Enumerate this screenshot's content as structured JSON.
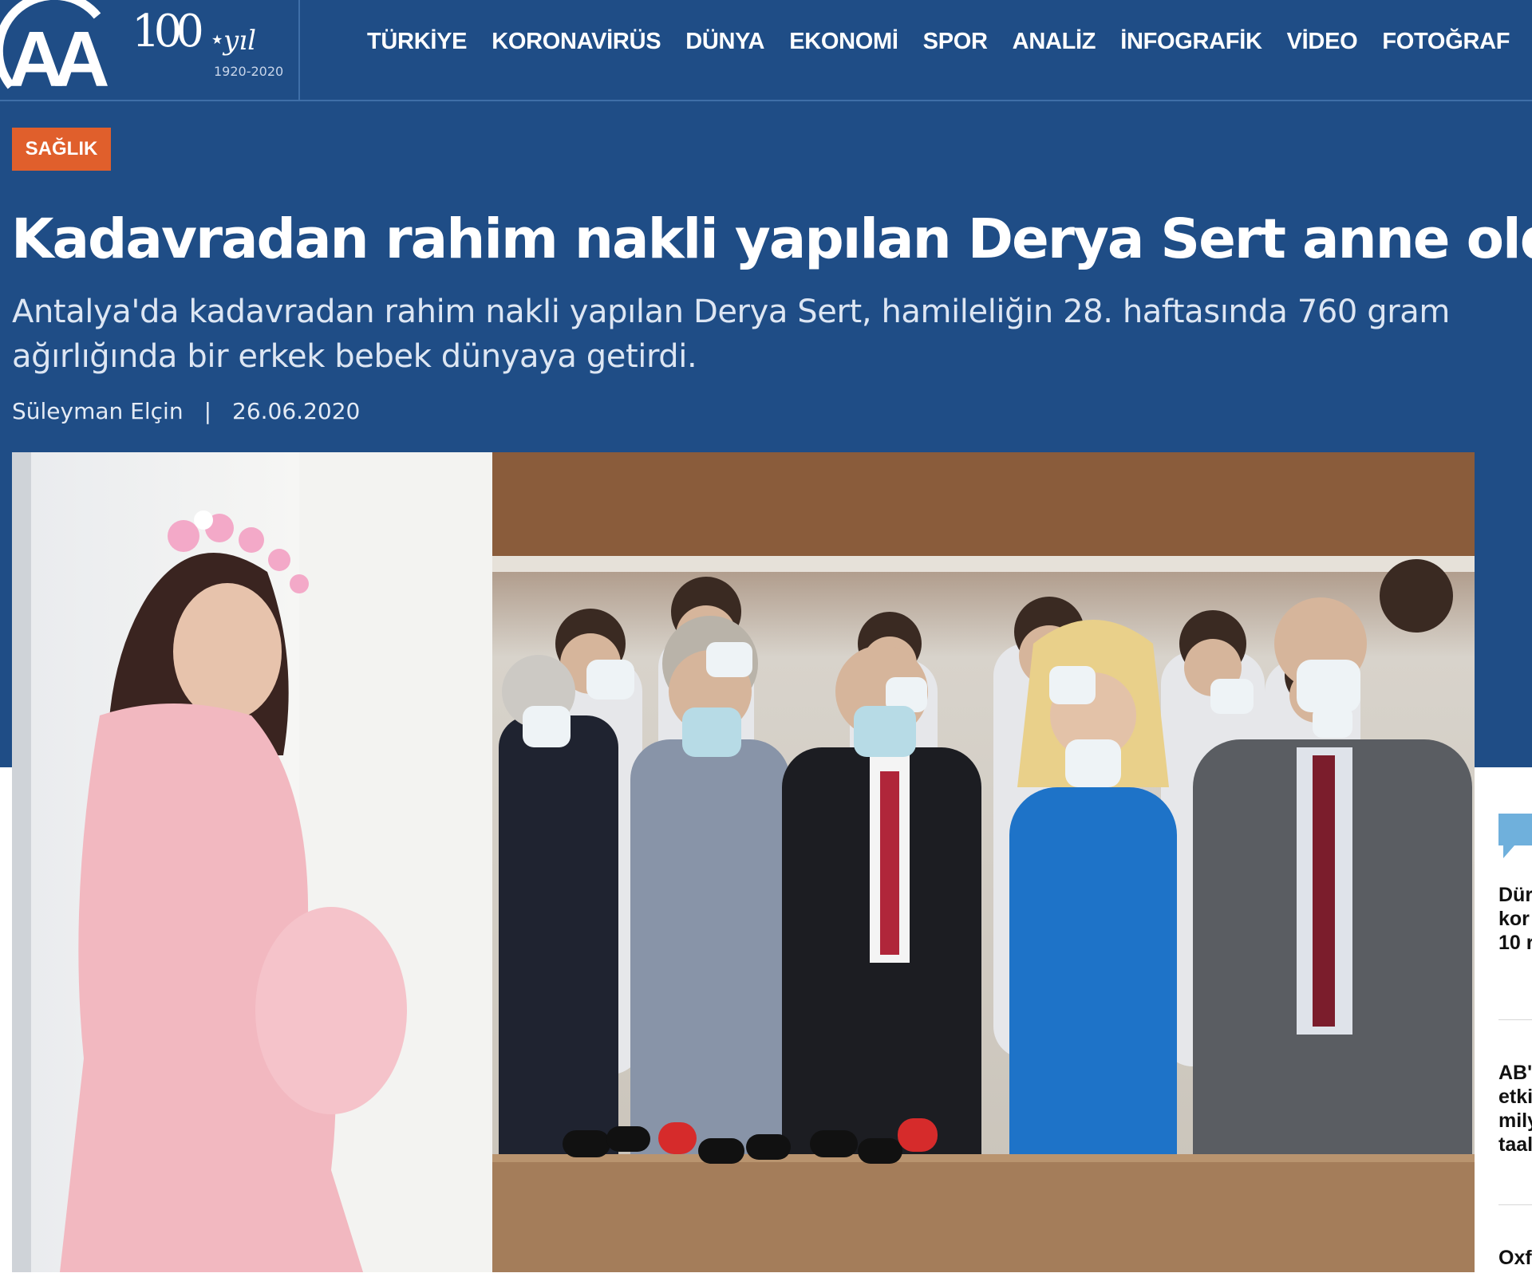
{
  "brand": {
    "logo_text": "AA",
    "centennial_number": "100",
    "centennial_unit": "yıl",
    "centennial_years": "1920-2020"
  },
  "nav": {
    "items": [
      "TÜRKİYE",
      "KORONAVİRÜS",
      "DÜNYA",
      "EKONOMİ",
      "SPOR",
      "ANALİZ",
      "İNFOGRAFİK",
      "VİDEO",
      "FOTOĞRAF"
    ]
  },
  "article": {
    "category": "SAĞLIK",
    "headline": "Kadavradan rahim nakli yapılan Derya Sert anne oldu",
    "summary": "Antalya'da kadavradan rahim nakli yapılan Derya Sert, hamileliğin 28. haftasında 760 gram ağırlığında bir erkek bebek dünyaya getirdi.",
    "author": "Süleyman Elçin",
    "separator": "|",
    "date": "26.06.2020"
  },
  "sidebar": {
    "icon": "speech-bubble-icon",
    "items": [
      {
        "lines": [
          "Dür",
          "kor",
          "10 r"
        ]
      },
      {
        "lines": [
          "AB'",
          "etki",
          "mily",
          "taal"
        ]
      },
      {
        "lines": [
          "Oxf"
        ]
      }
    ]
  },
  "colors": {
    "header_bg": "#1f4d86",
    "category_badge": "#e05f2c",
    "text_light": "#ffffff"
  }
}
